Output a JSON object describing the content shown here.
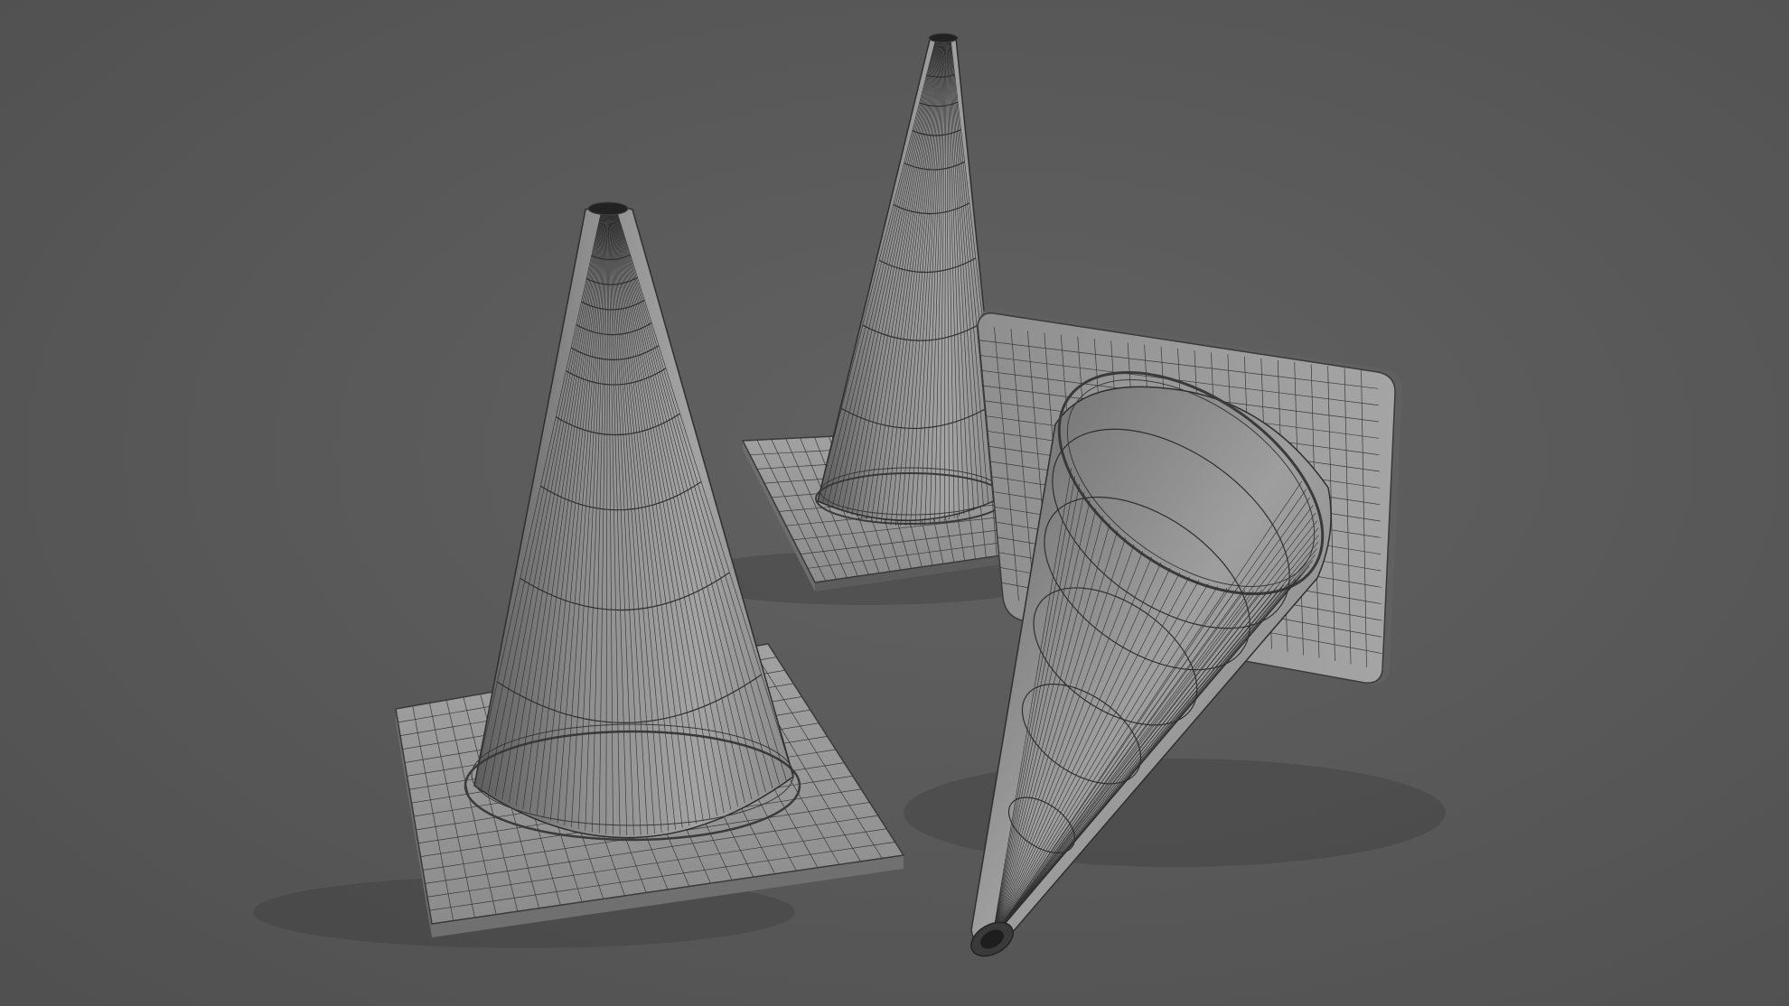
{
  "scene": {
    "subject": "traffic-cone-wireframe-render",
    "cone_count": 3,
    "background_color": "#5a5a5a",
    "shade_light": "#9c9c9c",
    "shade_mid": "#7e7e7e",
    "shade_dark": "#545454",
    "wire_color": "#2a2a2a"
  }
}
